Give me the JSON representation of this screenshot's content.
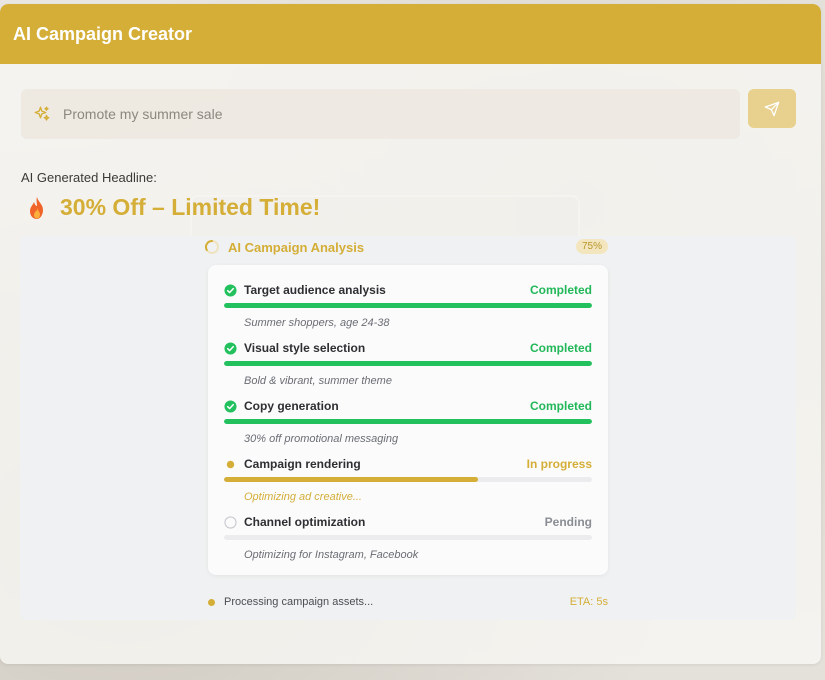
{
  "app": {
    "title": "AI Campaign Creator"
  },
  "prompt": {
    "placeholder": "Promote my summer sale",
    "value": ""
  },
  "headline": {
    "label": "AI Generated Headline:",
    "emoji": "🔥",
    "text": "30% Off – Limited Time!"
  },
  "analysis": {
    "title": "AI Campaign Analysis",
    "percent": "75%",
    "steps": [
      {
        "label": "Target audience analysis",
        "status": "Completed",
        "progress": 1.0,
        "description": "Summer shoppers, age 24-38"
      },
      {
        "label": "Visual style selection",
        "status": "Completed",
        "progress": 1.0,
        "description": "Bold & vibrant, summer theme"
      },
      {
        "label": "Copy generation",
        "status": "Completed",
        "progress": 1.0,
        "description": "30% off promotional messaging"
      },
      {
        "label": "Campaign rendering",
        "status": "In progress",
        "progress": 0.69,
        "description": "Optimizing ad creative..."
      },
      {
        "label": "Channel optimization",
        "status": "Pending",
        "progress": 0.0,
        "description": "Optimizing for Instagram, Facebook"
      }
    ],
    "footer": {
      "text": "Processing campaign assets...",
      "eta": "ETA: 5s"
    }
  },
  "icons": {
    "prompt": "sparkle-icon",
    "send": "send-icon",
    "headline": "fire-icon",
    "analysis": "loader-icon",
    "completed": "check-circle-icon",
    "in_progress": "dot-icon",
    "pending": "empty-circle-icon"
  },
  "colors": {
    "brand": "#d4ae37",
    "success": "#22c15e",
    "pending": "#8a8d93"
  }
}
